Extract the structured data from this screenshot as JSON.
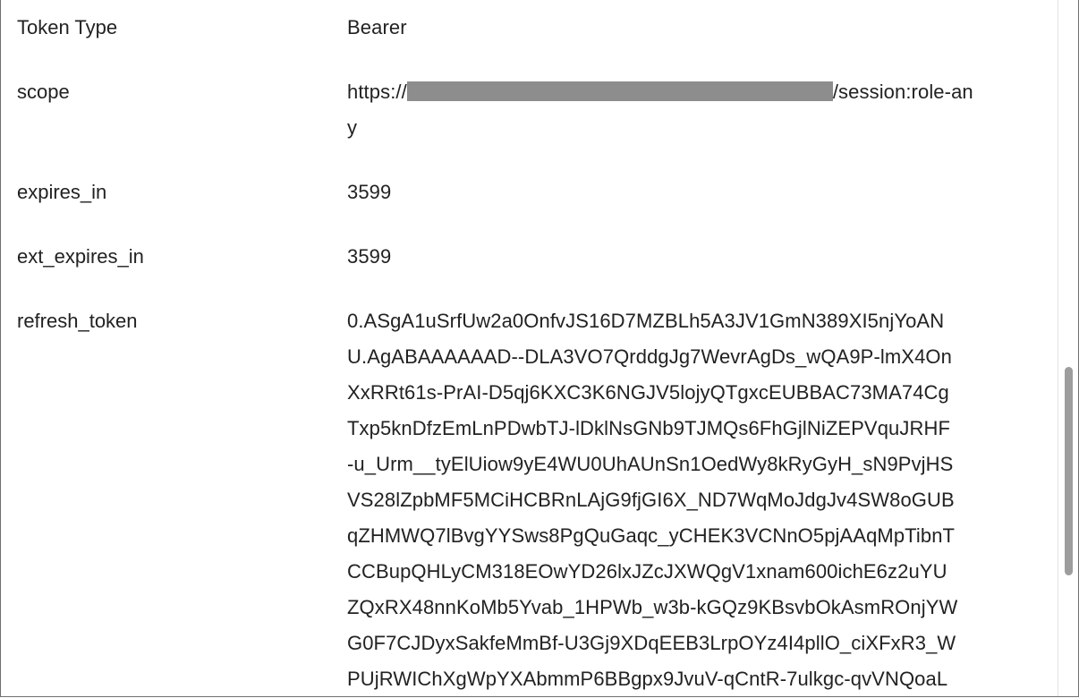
{
  "rows": [
    {
      "key": "Token Type",
      "value": "Bearer"
    },
    {
      "key": "scope",
      "value_prefix": "https://",
      "value_suffix": "/session:role-an",
      "value_wrap": "y"
    },
    {
      "key": "expires_in",
      "value": "3599"
    },
    {
      "key": "ext_expires_in",
      "value": "3599"
    },
    {
      "key": "refresh_token",
      "lines": [
        "0.ASgA1uSrfUw2a0OnfvJS16D7MZBLh5A3JV1GmN389XI5njYoAN",
        "U.AgABAAAAAAD--DLA3VO7QrddgJg7WevrAgDs_wQA9P-lmX4On",
        "XxRRt61s-PrAI-D5qj6KXC3K6NGJV5lojyQTgxcEUBBAC73MA74Cg",
        "Txp5knDfzEmLnPDwbTJ-lDklNsGNb9TJMQs6FhGjlNiZEPVquJRHF",
        "-u_Urm__tyElUiow9yE4WU0UhAUnSn1OedWy8kRyGyH_sN9PvjHS",
        "VS28lZpbMF5MCiHCBRnLAjG9fjGI6X_ND7WqMoJdgJv4SW8oGUB",
        "qZHMWQ7lBvgYYSws8PgQuGaqc_yCHEK3VCNnO5pjAAqMpTibnT",
        "CCBupQHLyCM318EOwYD26lxJZcJXWQgV1xnam600ichE6z2uYU",
        "ZQxRX48nnKoMb5Yvab_1HPWb_w3b-kGQz9KBsvbOkAsmROnjYW",
        "G0F7CJDyxSakfeMmBf-U3Gj9XDqEEB3LrpOYz4I4pllO_ciXFxR3_W",
        "PUjRWIChXgWpYXAbmmP6BBgpx9JvuV-qCntR-7ulkgc-qvVNQoaL"
      ]
    }
  ]
}
